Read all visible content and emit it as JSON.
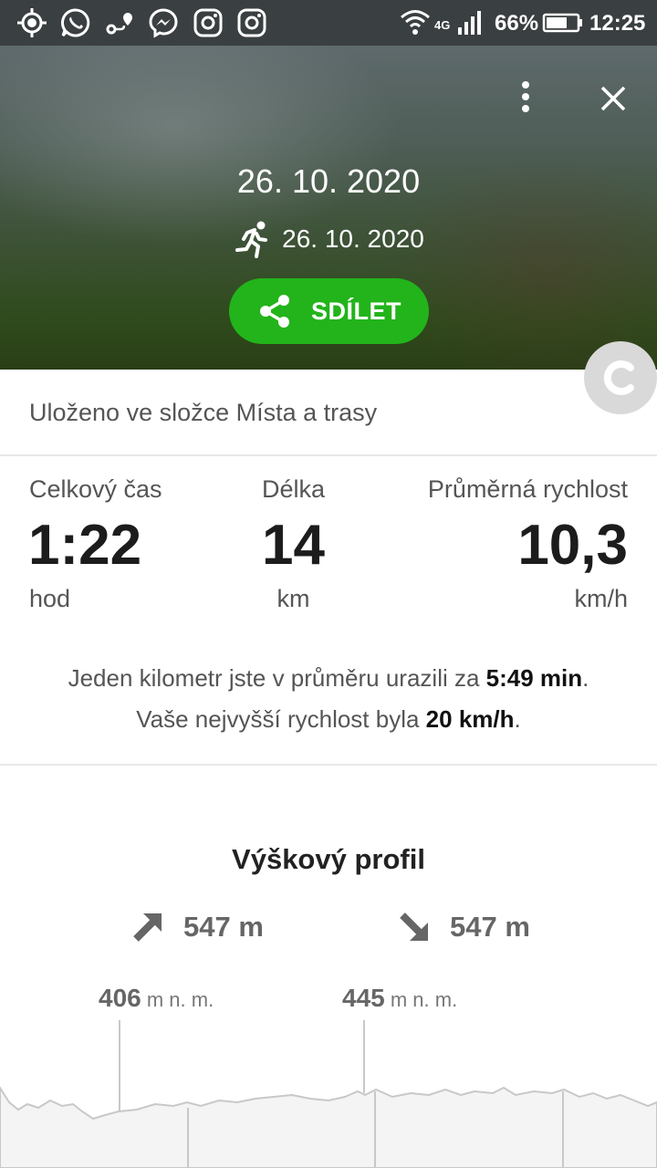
{
  "status_bar": {
    "battery": "66%",
    "time": "12:25",
    "network": "4G",
    "icons": [
      "location-target-icon",
      "whatsapp-icon",
      "route-icon",
      "messenger-icon",
      "instagram-icon",
      "instagram-icon",
      "wifi-icon",
      "signal-icon",
      "battery-icon"
    ]
  },
  "header": {
    "title": "26. 10. 2020",
    "activity_date": "26. 10. 2020",
    "activity_icon": "running-icon",
    "share_label": "SDÍLET"
  },
  "saved_text": "Uloženo ve složce Místa a trasy",
  "stats": {
    "time": {
      "label": "Celkový čas",
      "value": "1:22",
      "unit": "hod"
    },
    "distance": {
      "label": "Délka",
      "value": "14",
      "unit": "km"
    },
    "speed": {
      "label": "Průměrná rychlost",
      "value": "10,3",
      "unit": "km/h"
    }
  },
  "info": {
    "pace_prefix": "Jeden kilometr jste v průměru urazili za ",
    "pace_value": "5:49 min",
    "pace_suffix": ".",
    "max_prefix": "Vaše nejvyšší rychlost byla ",
    "max_value": "20 km/h",
    "max_suffix": "."
  },
  "elevation": {
    "title": "Výškový profil",
    "ascent": "547 m",
    "descent": "547 m",
    "markers": [
      {
        "value": "406",
        "unit": "m n. m."
      },
      {
        "value": "445",
        "unit": "m n. m."
      }
    ]
  },
  "colors": {
    "accent": "#22b41a",
    "statusbar": "#3a3f41"
  }
}
